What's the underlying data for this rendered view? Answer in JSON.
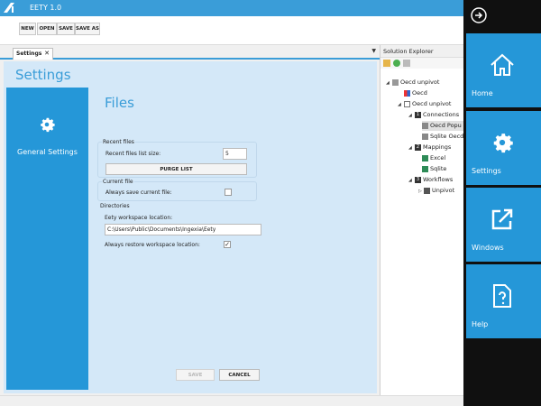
{
  "app": {
    "title": "EETY 1.0"
  },
  "toolbar": {
    "new": "NEW",
    "open": "OPEN",
    "save": "SAVE",
    "save_as": "SAVE AS"
  },
  "tab": {
    "label": "Settings",
    "close": "✕"
  },
  "settings": {
    "title": "Settings",
    "general_label": "General Settings",
    "files_title": "Files",
    "recent_files": {
      "group": "Recent files",
      "size_label": "Recent files list size:",
      "size_value": "5",
      "purge": "PURGE LIST"
    },
    "current_file": {
      "group": "Current file",
      "always_save_label": "Always save current file:",
      "always_save_checked": false
    },
    "directories": {
      "group": "Directories",
      "workspace_label": "Eety workspace location:",
      "workspace_value": "C:\\Users\\Public\\Documents\\Ingexia\\Eety",
      "restore_label": "Always restore workspace location:",
      "restore_checked": true,
      "check_mark": "✓"
    },
    "save": "SAVE",
    "cancel": "CANCEL"
  },
  "solution": {
    "header": "Solution Explorer",
    "tree": [
      {
        "label": "Oecd unpivot",
        "toggle": "◢"
      },
      {
        "label": "Oecd"
      },
      {
        "label": "Oecd unpivot",
        "toggle": "◢"
      },
      {
        "label": "Connections",
        "badge": "1",
        "toggle": "◢"
      },
      {
        "label": "Oecd Popu",
        "selected": true
      },
      {
        "label": "Sqlite Oecd"
      },
      {
        "label": "Mappings",
        "badge": "2",
        "toggle": "◢"
      },
      {
        "label": "Excel"
      },
      {
        "label": "Sqlite"
      },
      {
        "label": "Workflows",
        "badge": "3",
        "toggle": "◢"
      },
      {
        "label": "Unpivot",
        "toggle": "▷"
      }
    ]
  },
  "charms": {
    "home": "Home",
    "settings": "Settings",
    "windows": "Windows",
    "help": "Help"
  },
  "colors": {
    "accent": "#2597d8",
    "titlebar": "#3a9dd8",
    "panel": "#d4e8f8",
    "charm_bg": "#101010"
  }
}
